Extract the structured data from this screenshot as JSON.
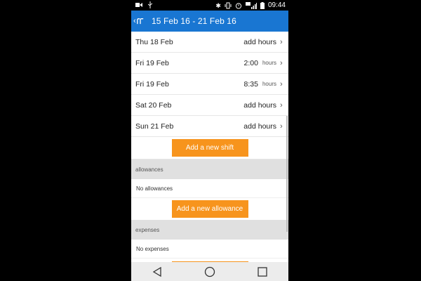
{
  "status_bar": {
    "time": "09:44",
    "icons": [
      "video-camera-icon",
      "usb-icon",
      "bluetooth-icon",
      "vibrate-icon",
      "alarm-icon",
      "signal-4g-icon",
      "battery-icon"
    ]
  },
  "app_bar": {
    "title": "15 Feb 16 - 21 Feb 16",
    "back_icon": "back-chevron-icon"
  },
  "days": [
    {
      "date": "Thu 18 Feb",
      "value": "add hours",
      "unit": ""
    },
    {
      "date": "Fri 19 Feb",
      "value": "2:00",
      "unit": "hours"
    },
    {
      "date": "Fri 19 Feb",
      "value": "8:35",
      "unit": "hours"
    },
    {
      "date": "Sat 20 Feb",
      "value": "add hours",
      "unit": ""
    },
    {
      "date": "Sun 21 Feb",
      "value": "add hours",
      "unit": ""
    }
  ],
  "add_shift_label": "Add a new shift",
  "allowances": {
    "header": "allowances",
    "empty_text": "No allowances",
    "button_label": "Add a new allowance"
  },
  "expenses": {
    "header": "expenses",
    "empty_text": "No expenses"
  },
  "colors": {
    "app_bar": "#1976d2",
    "accent": "#f7941d",
    "section_bg": "#e0e0e0"
  }
}
